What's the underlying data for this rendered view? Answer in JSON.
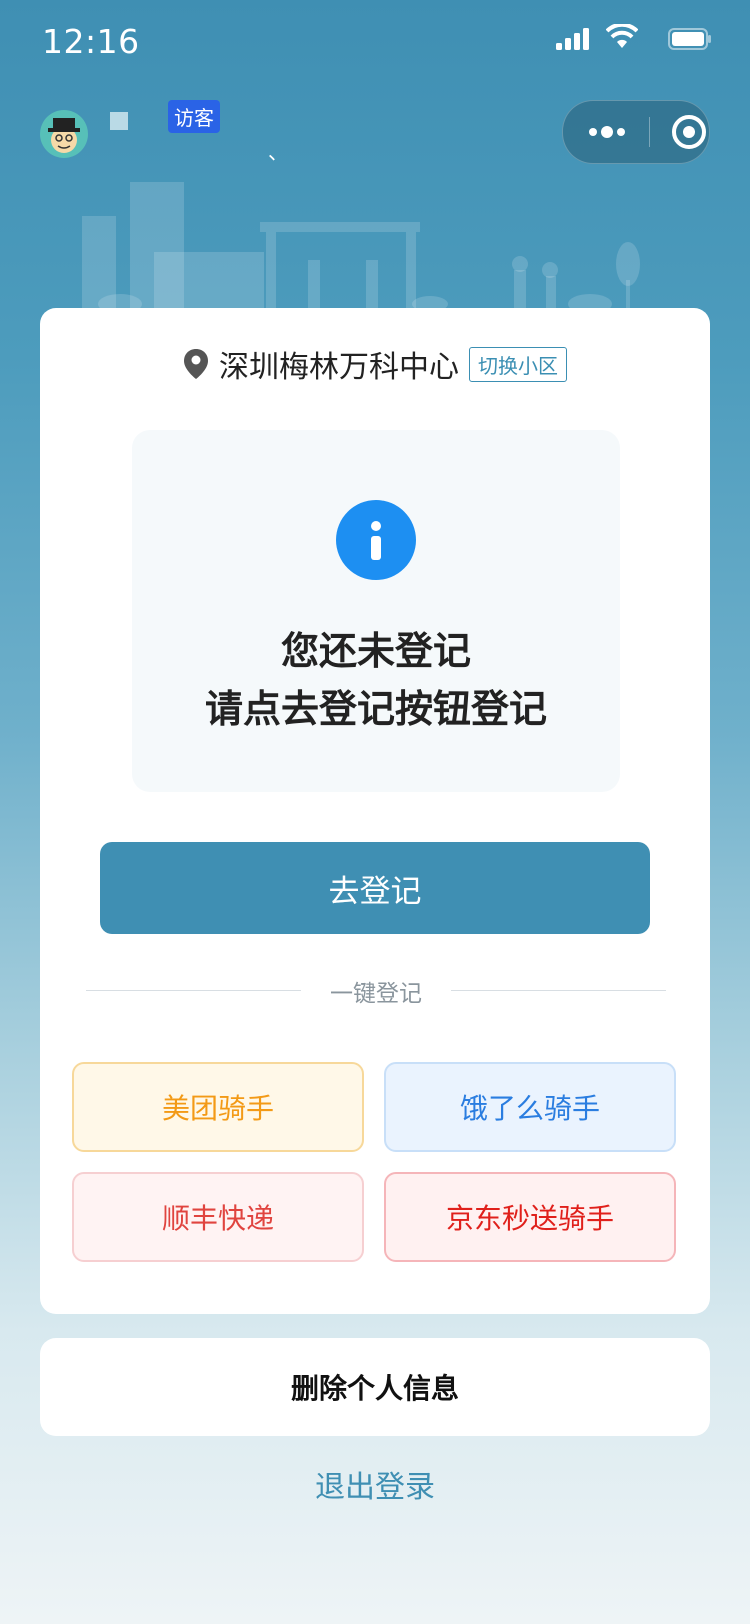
{
  "status_bar": {
    "time": "12:16"
  },
  "header": {
    "visitor_badge": "访客",
    "mark": "、"
  },
  "card": {
    "community_name": "深圳梅林万科中心",
    "switch_label": "切换小区",
    "notice_line1": "您还未登记",
    "notice_line2": "请点去登记按钮登记",
    "register_button": "去登记",
    "quick_divider": "一键登记",
    "quick_options": [
      "美团骑手",
      "饿了么骑手",
      "顺丰快递",
      "京东秒送骑手"
    ]
  },
  "delete_info_button": "删除个人信息",
  "logout_link": "退出登录",
  "colors": {
    "accent": "#3f8fb3",
    "info_blue": "#1d8ff2"
  },
  "icons": [
    "signal-icon",
    "wifi-icon",
    "battery-icon",
    "avatar-icon",
    "more-icon",
    "target-icon",
    "location-pin-icon",
    "info-icon"
  ]
}
